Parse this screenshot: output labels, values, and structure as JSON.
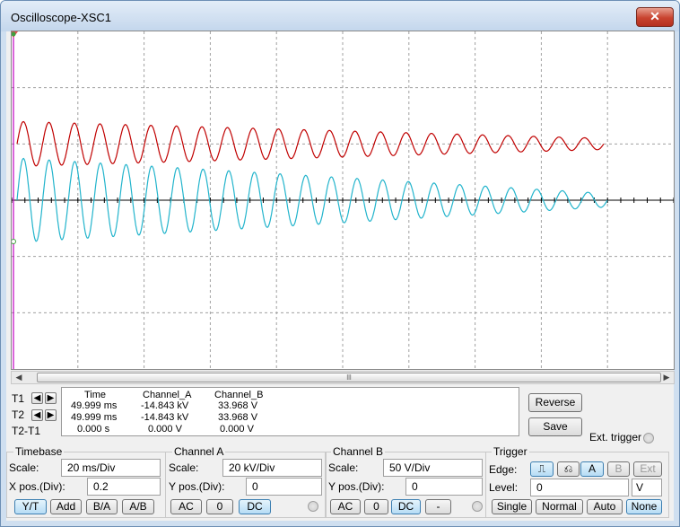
{
  "window": {
    "title": "Oscilloscope-XSC1",
    "close_glyph": "✕"
  },
  "scrollbar": {
    "left_arrow": "◀",
    "right_arrow": "▶",
    "thumb_grip": "lll"
  },
  "cursors": {
    "t1_label": "T1",
    "t2_label": "T2",
    "diff_label": "T2-T1",
    "left_glyph": "◀",
    "right_glyph": "▶"
  },
  "readout": {
    "headers": [
      "Time",
      "Channel_A",
      "Channel_B"
    ],
    "rows": [
      [
        "49.999 ms",
        "-14.843 kV",
        "33.968 V"
      ],
      [
        "49.999 ms",
        "-14.843 kV",
        "33.968 V"
      ],
      [
        "0.000 s",
        "0.000 V",
        "0.000 V"
      ]
    ]
  },
  "buttons": {
    "reverse": "Reverse",
    "save": "Save",
    "ext_trigger": "Ext. trigger"
  },
  "timebase": {
    "title": "Timebase",
    "scale_label": "Scale:",
    "scale_value": "20 ms/Div",
    "xpos_label": "X pos.(Div):",
    "xpos_value": "0.2",
    "modes": [
      "Y/T",
      "Add",
      "B/A",
      "A/B"
    ],
    "active_mode": "Y/T"
  },
  "channel_a": {
    "title": "Channel A",
    "scale_label": "Scale:",
    "scale_value": "20 kV/Div",
    "ypos_label": "Y pos.(Div):",
    "ypos_value": "0",
    "coupling": [
      "AC",
      "0",
      "DC"
    ],
    "active_coupling": "DC"
  },
  "channel_b": {
    "title": "Channel B",
    "scale_label": "Scale:",
    "scale_value": "50  V/Div",
    "ypos_label": "Y pos.(Div):",
    "ypos_value": "0",
    "coupling": [
      "AC",
      "0",
      "DC",
      "-"
    ],
    "active_coupling": "DC"
  },
  "trigger": {
    "title": "Trigger",
    "edge_label": "Edge:",
    "edge_rising": "⎍",
    "edge_falling": "⎌",
    "sources": [
      "A",
      "B",
      "Ext"
    ],
    "active_source": "A",
    "level_label": "Level:",
    "level_value": "0",
    "level_unit": "V",
    "modes": [
      "Single",
      "Normal",
      "Auto",
      "None"
    ],
    "active_mode": "None"
  },
  "display": {
    "background": "#ffffff",
    "grid_color": "#a0a0a0",
    "channel_a_color": "#c00000",
    "channel_b_color": "#22b4cc",
    "cursor_color": "#c000c0"
  },
  "chart_data": {
    "type": "line",
    "divisions": {
      "x": 10,
      "y": 6
    },
    "x_units_per_div": "20 ms/Div",
    "series": [
      {
        "name": "Channel_A",
        "color": "#c00000",
        "offset_div": 1.0,
        "start_amp_div": 0.4,
        "end_amp_div": 0.1,
        "cycles": 23,
        "scale": "20 kV/Div"
      },
      {
        "name": "Channel_B",
        "color": "#22b4cc",
        "offset_div": 0.0,
        "start_amp_div": 0.75,
        "end_amp_div": 0.12,
        "cycles": 23,
        "scale": "50 V/Div"
      }
    ],
    "cursor_t1_div": 0.0
  }
}
